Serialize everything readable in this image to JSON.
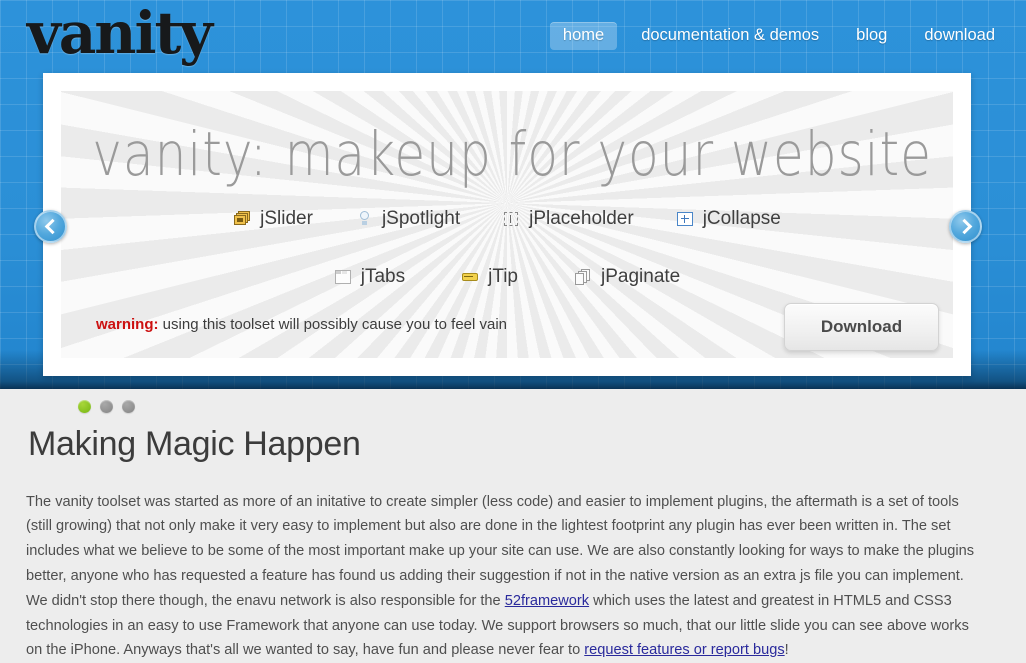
{
  "site": {
    "logo": "vanity",
    "nav": [
      {
        "label": "home",
        "active": true
      },
      {
        "label": "documentation & demos",
        "active": false
      },
      {
        "label": "blog",
        "active": false
      },
      {
        "label": "download",
        "active": false
      }
    ]
  },
  "hero": {
    "title": "vanity: makeup for your website",
    "plugins_row1": [
      {
        "name": "jSlider",
        "icon": "stacked-cards-icon"
      },
      {
        "name": "jSpotlight",
        "icon": "lightbulb-icon"
      },
      {
        "name": "jPlaceholder",
        "icon": "dotted-textbox-icon"
      },
      {
        "name": "jCollapse",
        "icon": "plus-box-icon"
      }
    ],
    "plugins_row2": [
      {
        "name": "jTabs",
        "icon": "tabbed-window-icon"
      },
      {
        "name": "jTip",
        "icon": "tooltip-icon"
      },
      {
        "name": "jPaginate",
        "icon": "stacked-pages-icon"
      }
    ],
    "warning_label": "warning:",
    "warning_text": "using this toolset will possibly cause you to feel vain",
    "download_label": "Download",
    "prev_label": "‹",
    "next_label": "›"
  },
  "slider_dots": [
    {
      "state": "active"
    },
    {
      "state": "idle"
    },
    {
      "state": "idle"
    }
  ],
  "content": {
    "heading": "Making Magic Happen",
    "paragraph_part1": "The vanity toolset was started as more of an initative to create simpler (less code) and easier to implement plugins, the aftermath is a set of tools (still growing) that not only make it very easy to implement but also are done in the lightest footprint any plugin has ever been written in. The set includes what we believe to be some of the most important make up your site can use. We are also constantly looking for ways to make the plugins better, anyone who has requested a feature has found us adding their suggestion if not in the native version as an extra js file you can implement. We didn't stop there though, the enavu network is also responsible for the ",
    "link1": "52framework",
    "paragraph_part2": " which uses the latest and greatest in HTML5 and CSS3 technologies in an easy to use Framework that anyone can use today. We support browsers so much, that our little slide you can see above works on the iPhone. Anyways that's all we wanted to say, have fun and please never fear to ",
    "link2": "request features or report bugs",
    "paragraph_part3": "!"
  },
  "colors": {
    "brand_blue": "#2d92da",
    "warning_red": "#cc1111",
    "link_navy": "#2a2a9c",
    "dot_active_green": "#8ec63f",
    "panel_gray": "#ebebeb"
  }
}
